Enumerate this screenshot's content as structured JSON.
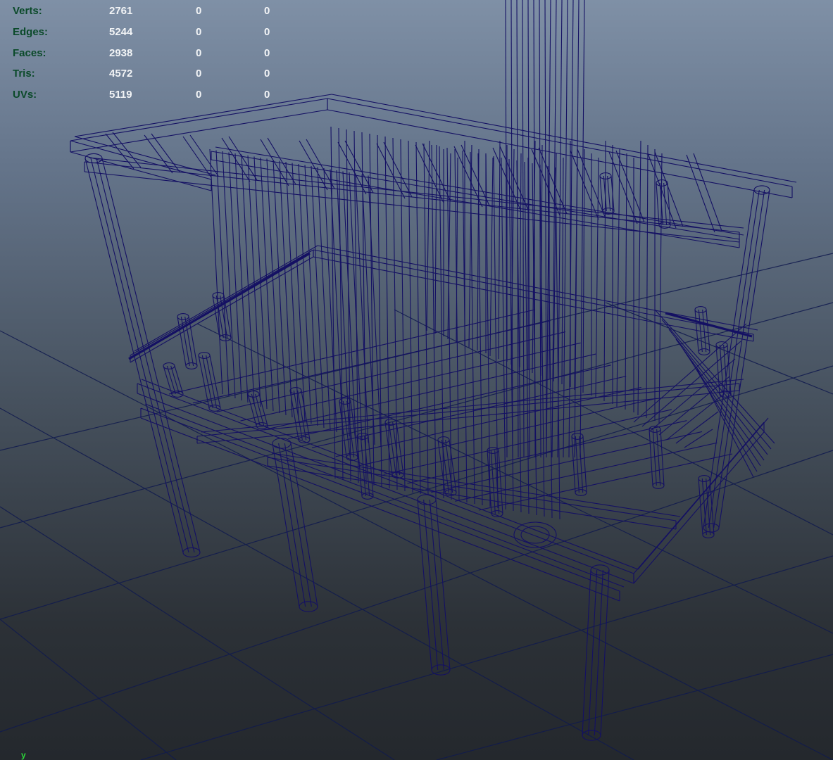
{
  "hud": {
    "rows": [
      {
        "label": "Verts:",
        "total": "2761",
        "selected": "0",
        "count": "0"
      },
      {
        "label": "Edges:",
        "total": "5244",
        "selected": "0",
        "count": "0"
      },
      {
        "label": "Faces:",
        "total": "2938",
        "selected": "0",
        "count": "0"
      },
      {
        "label": "Tris:",
        "total": "4572",
        "selected": "0",
        "count": "0"
      },
      {
        "label": "UVs:",
        "total": "5119",
        "selected": "0",
        "count": "0"
      }
    ]
  },
  "axis": {
    "label": "y"
  },
  "colors": {
    "wireframe": "#141063",
    "grid": "#101a4e",
    "hud_label": "#0b4a2a",
    "hud_value": "#f2f4f6",
    "axis_y": "#2cd93a"
  }
}
